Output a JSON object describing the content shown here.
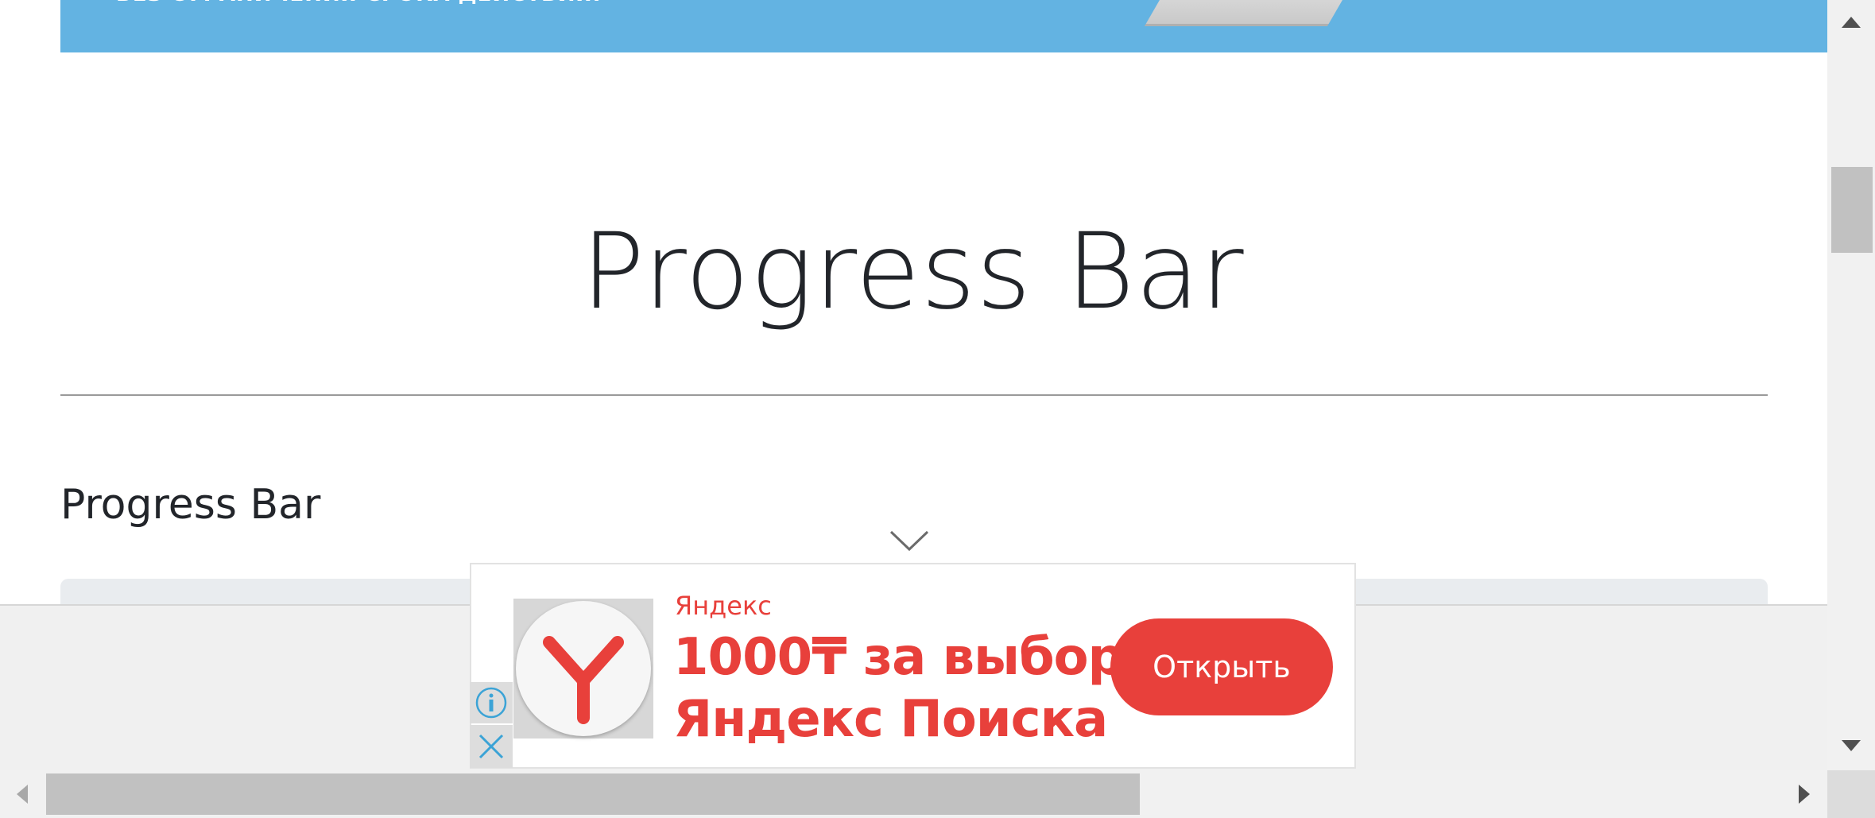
{
  "top_banner": {
    "text": "БЕЗ ОГРАНИЧЕНИЯ СРОКА ДЕЙСТВИЯ.",
    "background_color": "#63b3e2"
  },
  "page": {
    "title": "Progress Bar",
    "section_heading": "Progress Bar"
  },
  "icons": {
    "collapse": "chevron-down-icon",
    "ad_logo": "yandex-logo-icon",
    "ad_info": "info-icon",
    "ad_close": "close-icon",
    "scroll_up": "triangle-up-icon",
    "scroll_down": "triangle-down-icon",
    "scroll_left": "triangle-left-icon",
    "scroll_right": "triangle-right-icon"
  },
  "ad": {
    "source": "Яндекс",
    "headline_line1": "1000₸ за выбор",
    "headline_line2": "Яндекс Поиска",
    "button_label": "Открыть",
    "accent_color": "#e8403b"
  }
}
